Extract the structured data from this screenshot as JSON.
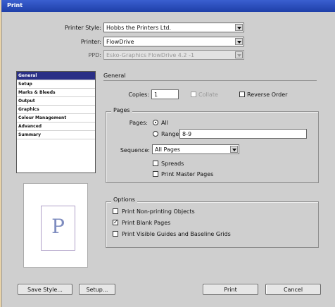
{
  "window": {
    "title": "Print"
  },
  "printer_style": {
    "label": "Printer Style:",
    "value": "Hobbs the Printers Ltd."
  },
  "printer": {
    "label": "Printer:",
    "value": "FlowDrive"
  },
  "ppd": {
    "label": "PPD:",
    "value": "Esko-Graphics FlowDrive 4.2 -1"
  },
  "categories": [
    {
      "label": "General"
    },
    {
      "label": "Setup"
    },
    {
      "label": "Marks & Bleeds"
    },
    {
      "label": "Output"
    },
    {
      "label": "Graphics"
    },
    {
      "label": "Colour Management"
    },
    {
      "label": "Advanced"
    },
    {
      "label": "Summary"
    }
  ],
  "preview": {
    "letter": "P"
  },
  "general": {
    "title": "General",
    "copies_label": "Copies:",
    "copies_value": "1",
    "collate_label": "Collate",
    "reverse_label": "Reverse Order"
  },
  "pages": {
    "title": "Pages",
    "pages_label": "Pages:",
    "all_label": "All",
    "range_label": "Range:",
    "range_value": "8-9",
    "sequence_label": "Sequence:",
    "sequence_value": "All Pages",
    "spreads_label": "Spreads",
    "master_label": "Print Master Pages"
  },
  "options": {
    "title": "Options",
    "nonprinting_label": "Print Non-printing Objects",
    "blank_label": "Print Blank Pages",
    "guides_label": "Print Visible Guides and Baseline Grids",
    "blank_mark": "✓"
  },
  "buttons": {
    "save_style": "Save Style...",
    "setup": "Setup...",
    "print": "Print",
    "cancel": "Cancel"
  }
}
